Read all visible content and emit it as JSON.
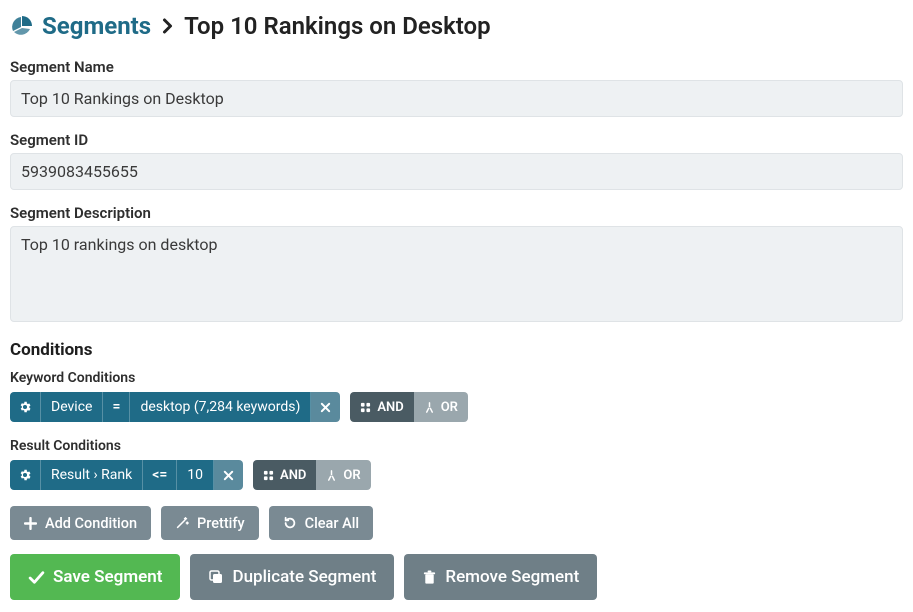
{
  "breadcrumb": {
    "root": "Segments",
    "current": "Top 10 Rankings on Desktop"
  },
  "fields": {
    "name_label": "Segment Name",
    "name_value": "Top 10 Rankings on Desktop",
    "id_label": "Segment ID",
    "id_value": "5939083455655",
    "desc_label": "Segment Description",
    "desc_value": "Top 10 rankings on desktop"
  },
  "conditions": {
    "heading": "Conditions",
    "keyword_label": "Keyword Conditions",
    "keyword_tag": {
      "field": "Device",
      "op": "=",
      "value": "desktop (7,284 keywords)"
    },
    "result_label": "Result Conditions",
    "result_tag": {
      "field": "Result › Rank",
      "op": "<=",
      "value": "10"
    },
    "logic_and": "AND",
    "logic_or": "OR"
  },
  "buttons": {
    "add_condition": "Add Condition",
    "prettify": "Prettify",
    "clear_all": "Clear All",
    "save": "Save Segment",
    "duplicate": "Duplicate Segment",
    "remove": "Remove Segment"
  }
}
